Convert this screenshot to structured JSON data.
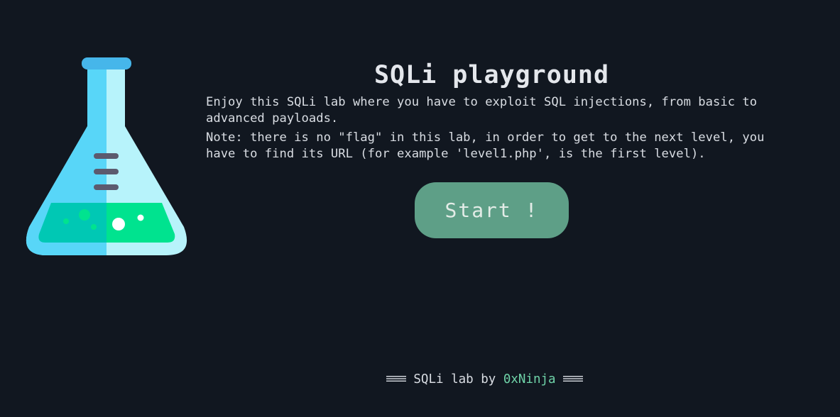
{
  "header": {
    "title": "SQLi playground"
  },
  "intro": {
    "paragraph1": "Enjoy this SQLi lab where you have to exploit SQL injections, from basic to advanced payloads.",
    "paragraph2": "Note: there is no \"flag\" in this lab, in order to get to the next level, you have to find its URL (for example 'level1.php', is the first level)."
  },
  "actions": {
    "start_label": "Start !"
  },
  "footer": {
    "prefix": "SQLi lab by",
    "author": "0xNinja"
  },
  "icons": {
    "illustration": "lab-flask-icon",
    "footer_decoration": "triple-line-icon"
  },
  "colors": {
    "background": "#111720",
    "button": "#5e9f87",
    "author_link": "#6fd3a8",
    "flask_light": "#b7f3fb",
    "flask_blue": "#58d6f8",
    "liquid_green": "#00e38f",
    "liquid_teal": "#00c8b4"
  }
}
